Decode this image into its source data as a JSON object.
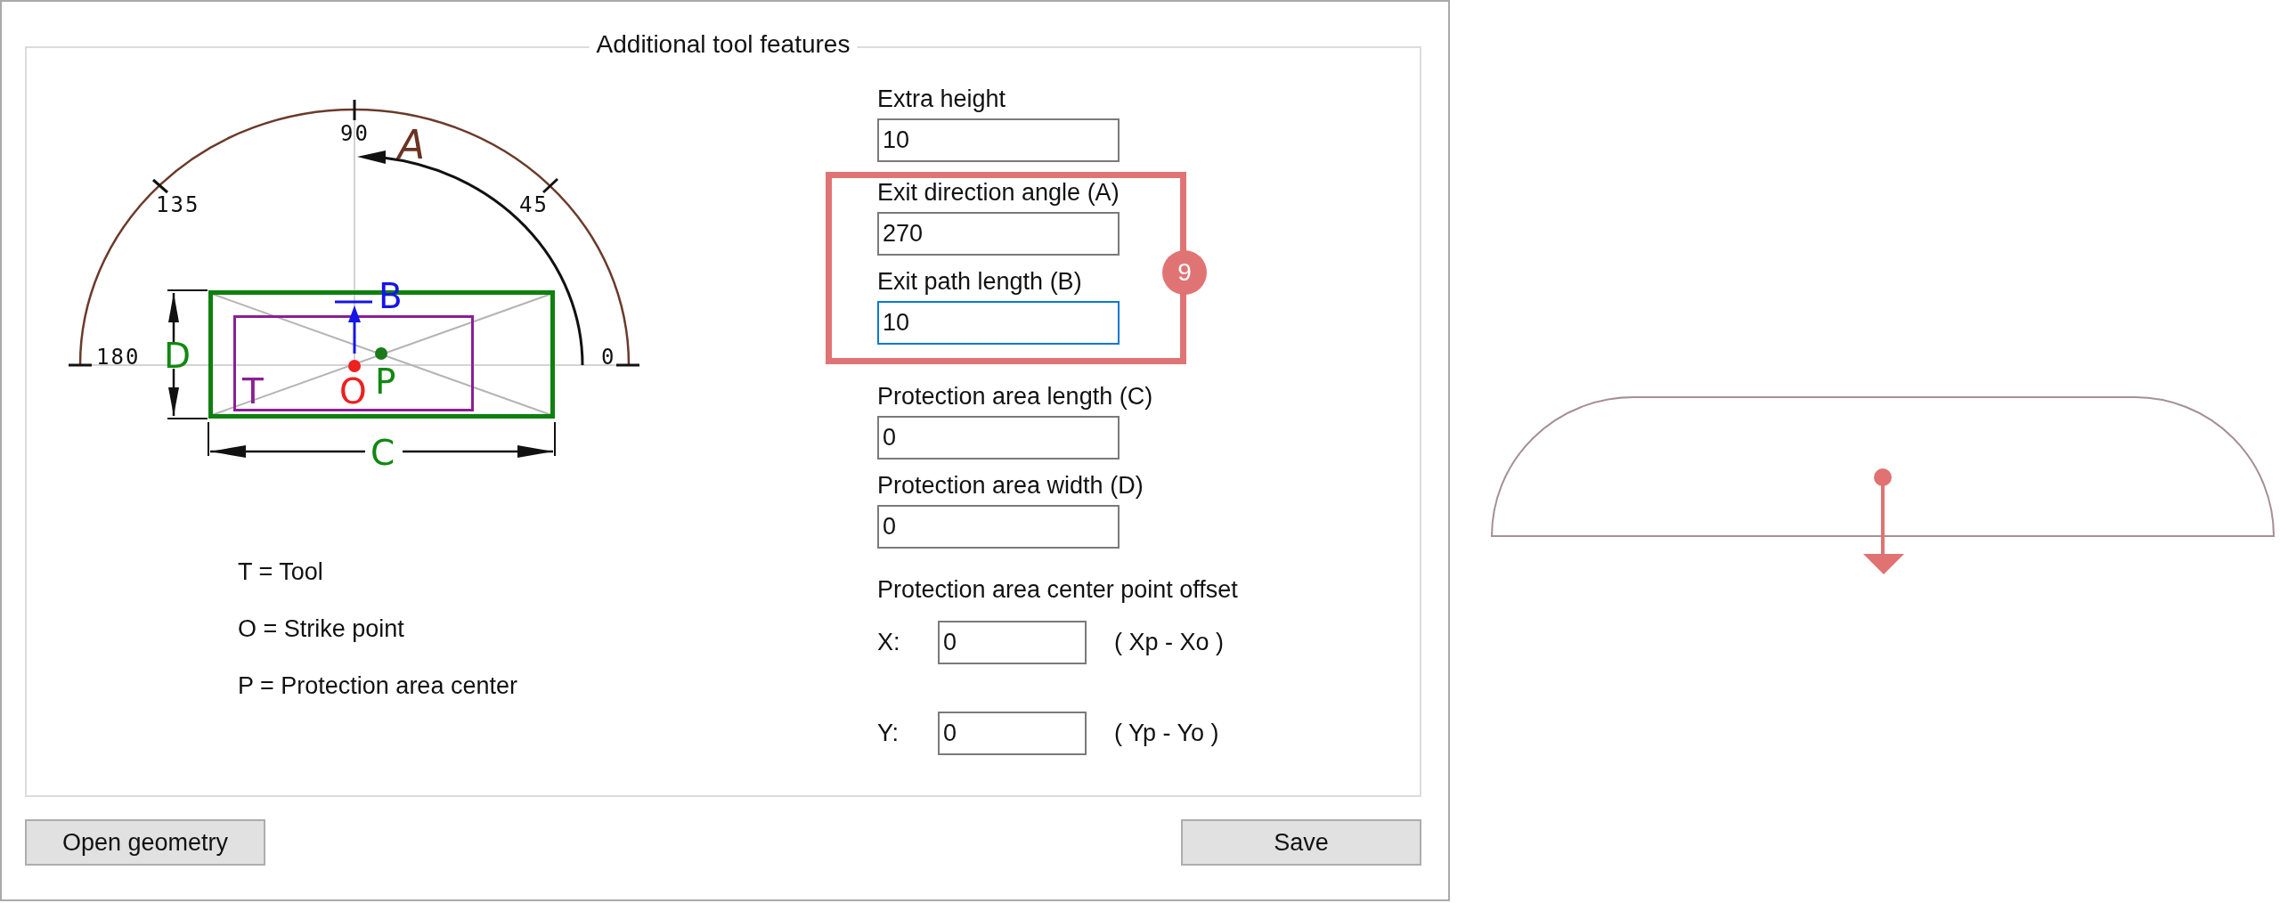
{
  "dialog": {
    "group_title": "Additional tool features"
  },
  "diagram": {
    "scale_labels": [
      "0",
      "45",
      "90",
      "135",
      "180"
    ],
    "angle_letter": "A",
    "exit_letter": "B",
    "length_letter": "C",
    "width_letter": "D",
    "tool_letter": "T",
    "strike_letter": "O",
    "center_letter": "P"
  },
  "legend": [
    "T = Tool",
    "O = Strike point",
    "P = Protection area center"
  ],
  "fields": [
    {
      "label": "Extra height",
      "value": "10",
      "focused": false,
      "highlighted": false
    },
    {
      "label": "Exit direction angle (A)",
      "value": "270",
      "focused": false,
      "highlighted": true
    },
    {
      "label": "Exit path length (B)",
      "value": "10",
      "focused": true,
      "highlighted": true
    },
    {
      "label": "Protection area length (C)",
      "value": "0",
      "focused": false,
      "highlighted": false
    },
    {
      "label": "Protection area width (D)",
      "value": "0",
      "focused": false,
      "highlighted": false
    }
  ],
  "callout": {
    "badge": "9"
  },
  "offset": {
    "title": "Protection area center point offset",
    "rows": [
      {
        "axis": "X:",
        "value": "0",
        "formula": "( Xp - Xo )"
      },
      {
        "axis": "Y:",
        "value": "0",
        "formula": "( Yp - Yo )"
      }
    ]
  },
  "buttons": [
    {
      "label": "Open geometry"
    },
    {
      "label": "Save"
    }
  ]
}
